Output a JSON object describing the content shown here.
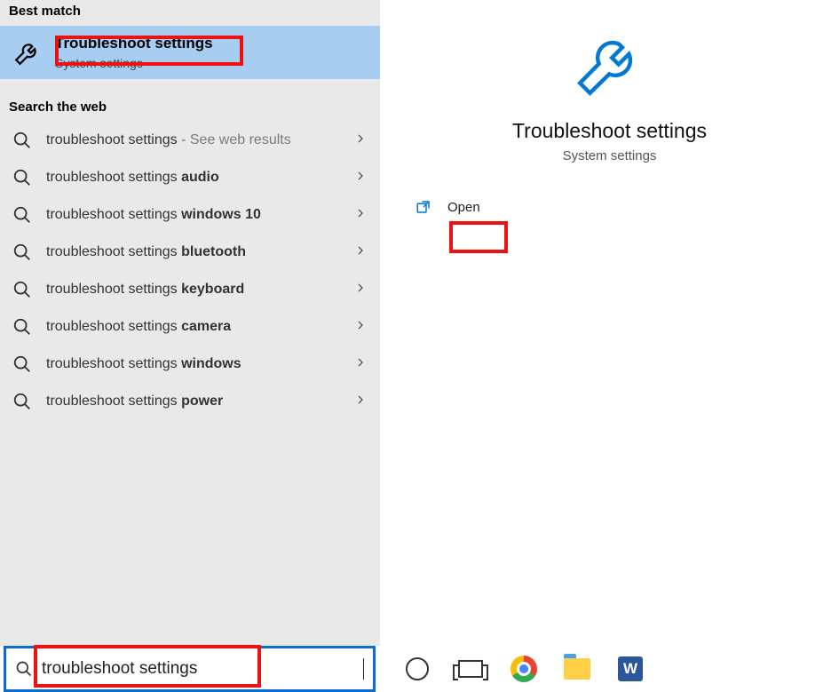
{
  "left": {
    "best_match_header": "Best match",
    "best_match": {
      "title": "Troubleshoot settings",
      "subtitle": "System settings"
    },
    "search_web_header": "Search the web",
    "web_items": [
      {
        "prefix": "troubleshoot settings",
        "bold": "",
        "suffix": " - See web results"
      },
      {
        "prefix": "troubleshoot settings ",
        "bold": "audio",
        "suffix": ""
      },
      {
        "prefix": "troubleshoot settings ",
        "bold": "windows 10",
        "suffix": ""
      },
      {
        "prefix": "troubleshoot settings ",
        "bold": "bluetooth",
        "suffix": ""
      },
      {
        "prefix": "troubleshoot settings ",
        "bold": "keyboard",
        "suffix": ""
      },
      {
        "prefix": "troubleshoot settings ",
        "bold": "camera",
        "suffix": ""
      },
      {
        "prefix": "troubleshoot settings ",
        "bold": "windows",
        "suffix": ""
      },
      {
        "prefix": "troubleshoot settings ",
        "bold": "power",
        "suffix": ""
      }
    ]
  },
  "right": {
    "title": "Troubleshoot settings",
    "subtitle": "System settings",
    "actions": {
      "open": "Open"
    }
  },
  "search": {
    "value": "troubleshoot settings"
  },
  "taskbar": {
    "word_glyph": "W"
  }
}
